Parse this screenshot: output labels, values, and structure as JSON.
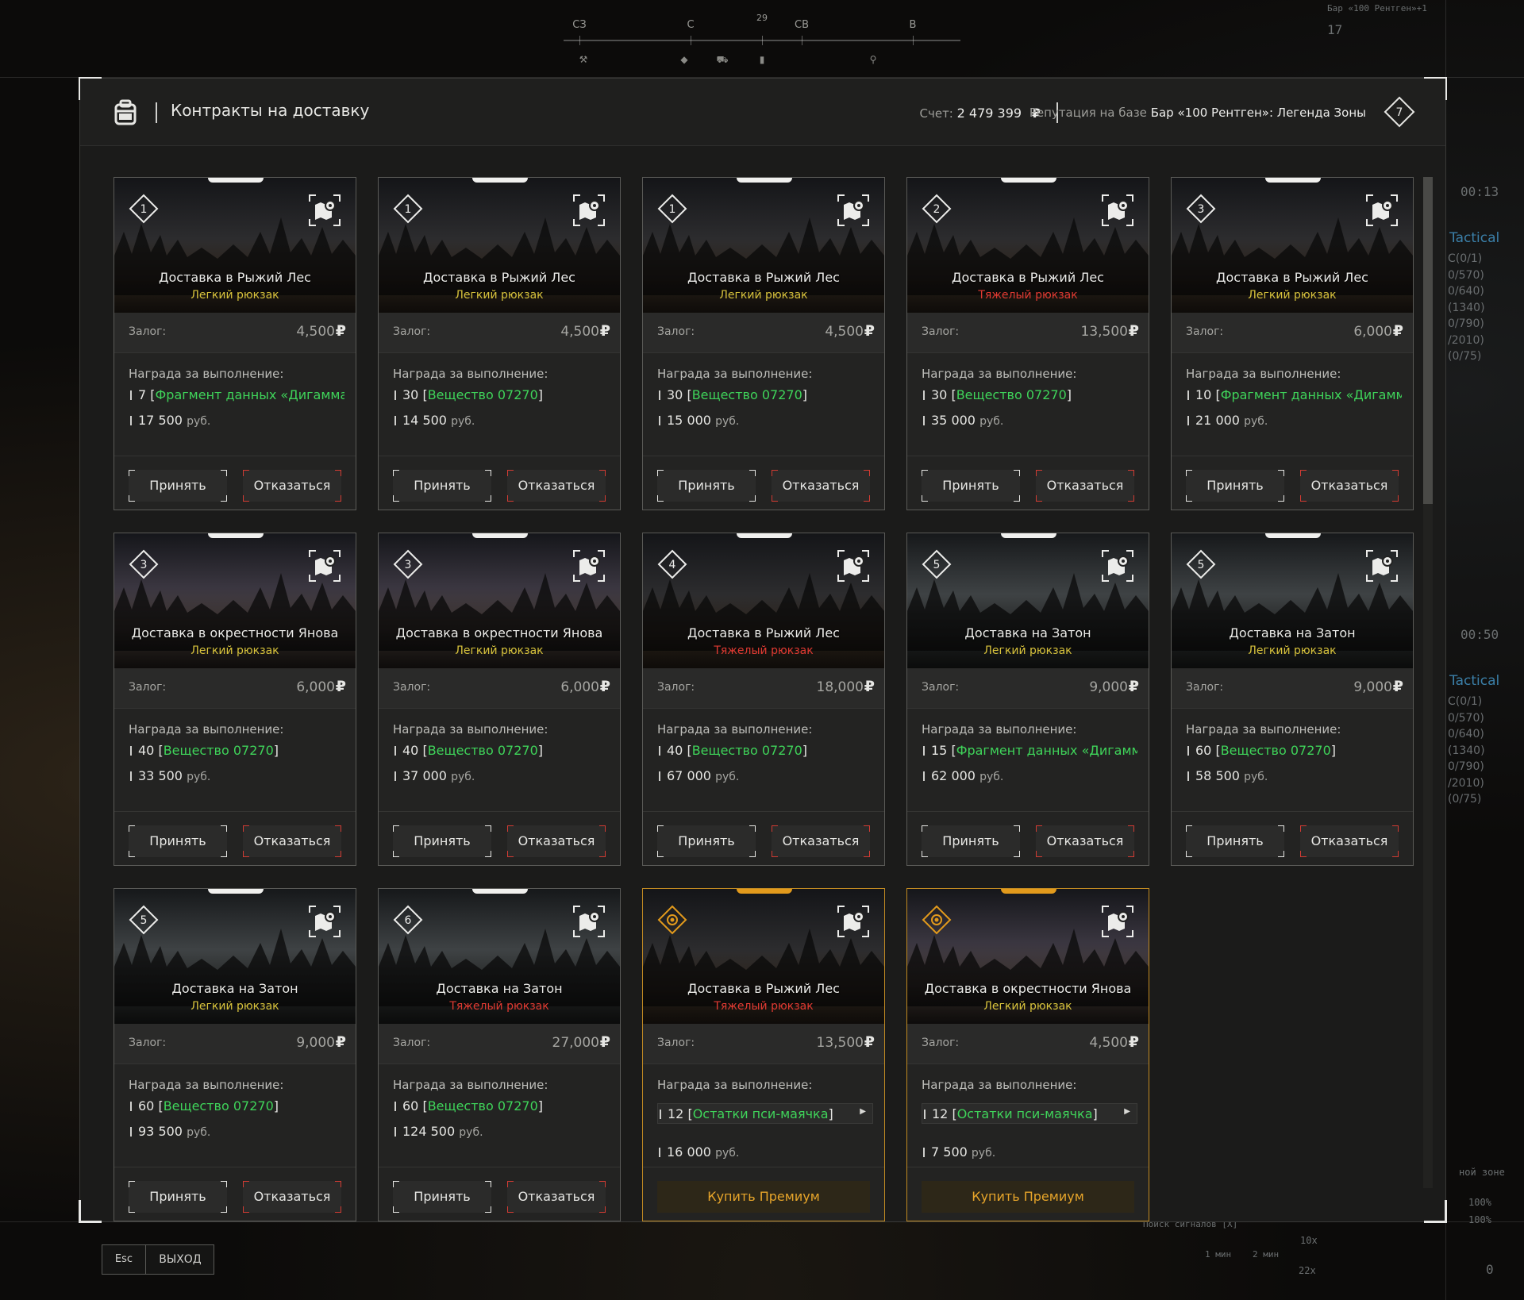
{
  "compass": {
    "labels": [
      "СЗ",
      "С",
      "29",
      "СВ",
      "В"
    ]
  },
  "hud": {
    "top_right_label": "Бар «100 Рентген»+1",
    "top_right_number": "17",
    "timer1": "00:13",
    "timer2": "00:50",
    "tactical": "Tactical",
    "stats": [
      "С(0/1)",
      "0/570)",
      "0/640)",
      "(1340)",
      "0/790)",
      "/2010)",
      "(0/75)"
    ],
    "zone_label": "ной зоне",
    "pct1": "100%",
    "pct2": "100%",
    "signal": "Поиск сигналов [X]",
    "t1": "1 мин",
    "t2": "2 мин",
    "count": "10x",
    "ammo": "22x",
    "zero": "0"
  },
  "header": {
    "title": "Контракты на доставку",
    "score_label": "Счет:",
    "score_value": "2 479 399",
    "currency": "₽",
    "rep_label": "Репутация на базе",
    "rep_value": "Бар «100 Рентген»: Легенда Зоны",
    "rep_level": "7"
  },
  "labels": {
    "deposit": "Залог:",
    "reward": "Награда за выполнение:",
    "rub": "руб.",
    "accept": "Принять",
    "decline": "Отказаться",
    "buy": "Купить Премиум",
    "currency": "₽"
  },
  "cards": [
    {
      "level": "1",
      "title": "Доставка в Рыжий Лес",
      "bag": "Легкий рюкзак",
      "heavy": false,
      "deposit": "4,500",
      "item_qty": "7",
      "item_name": "Фрагмент данных «Дигамма»",
      "money": "17 500",
      "premium": false,
      "bgvar": "v1"
    },
    {
      "level": "1",
      "title": "Доставка в Рыжий Лес",
      "bag": "Легкий рюкзак",
      "heavy": false,
      "deposit": "4,500",
      "item_qty": "30",
      "item_name": "Вещество 07270",
      "money": "14 500",
      "premium": false,
      "bgvar": "v1"
    },
    {
      "level": "1",
      "title": "Доставка в Рыжий Лес",
      "bag": "Легкий рюкзак",
      "heavy": false,
      "deposit": "4,500",
      "item_qty": "30",
      "item_name": "Вещество 07270",
      "money": "15 000",
      "premium": false,
      "bgvar": "v1"
    },
    {
      "level": "2",
      "title": "Доставка в Рыжий Лес",
      "bag": "Тяжелый рюкзак",
      "heavy": true,
      "deposit": "13,500",
      "item_qty": "30",
      "item_name": "Вещество 07270",
      "money": "35 000",
      "premium": false,
      "bgvar": "v1"
    },
    {
      "level": "3",
      "title": "Доставка в Рыжий Лес",
      "bag": "Легкий рюкзак",
      "heavy": false,
      "deposit": "6,000",
      "item_qty": "10",
      "item_name": "Фрагмент данных «Дигамма..",
      "money": "21 000",
      "premium": false,
      "bgvar": "v1"
    },
    {
      "level": "3",
      "title": "Доставка в окрестности Янова",
      "bag": "Легкий рюкзак",
      "heavy": false,
      "deposit": "6,000",
      "item_qty": "40",
      "item_name": "Вещество 07270",
      "money": "33 500",
      "premium": false,
      "bgvar": "v2"
    },
    {
      "level": "3",
      "title": "Доставка в окрестности Янова",
      "bag": "Легкий рюкзак",
      "heavy": false,
      "deposit": "6,000",
      "item_qty": "40",
      "item_name": "Вещество 07270",
      "money": "37 000",
      "premium": false,
      "bgvar": "v2"
    },
    {
      "level": "4",
      "title": "Доставка в Рыжий Лес",
      "bag": "Тяжелый рюкзак",
      "heavy": true,
      "deposit": "18,000",
      "item_qty": "40",
      "item_name": "Вещество 07270",
      "money": "67 000",
      "premium": false,
      "bgvar": "v1"
    },
    {
      "level": "5",
      "title": "Доставка на Затон",
      "bag": "Легкий рюкзак",
      "heavy": false,
      "deposit": "9,000",
      "item_qty": "15",
      "item_name": "Фрагмент данных «Дигамма..",
      "money": "62 000",
      "premium": false,
      "bgvar": "v3"
    },
    {
      "level": "5",
      "title": "Доставка на Затон",
      "bag": "Легкий рюкзак",
      "heavy": false,
      "deposit": "9,000",
      "item_qty": "60",
      "item_name": "Вещество 07270",
      "money": "58 500",
      "premium": false,
      "bgvar": "v3"
    },
    {
      "level": "5",
      "title": "Доставка на Затон",
      "bag": "Легкий рюкзак",
      "heavy": false,
      "deposit": "9,000",
      "item_qty": "60",
      "item_name": "Вещество 07270",
      "money": "93 500",
      "premium": false,
      "bgvar": "v3"
    },
    {
      "level": "6",
      "title": "Доставка на Затон",
      "bag": "Тяжелый рюкзак",
      "heavy": true,
      "deposit": "27,000",
      "item_qty": "60",
      "item_name": "Вещество 07270",
      "money": "124 500",
      "premium": false,
      "bgvar": "v3"
    },
    {
      "level": "",
      "title": "Доставка в Рыжий Лес",
      "bag": "Тяжелый рюкзак",
      "heavy": true,
      "deposit": "13,500",
      "item_qty": "12",
      "item_name": "Остатки пси-маячка",
      "money": "16 000",
      "premium": true,
      "bgvar": "v1"
    },
    {
      "level": "",
      "title": "Доставка в окрестности Янова",
      "bag": "Легкий рюкзак",
      "heavy": false,
      "deposit": "4,500",
      "item_qty": "12",
      "item_name": "Остатки пси-маячка",
      "money": "7 500",
      "premium": true,
      "bgvar": "v2"
    }
  ],
  "footer": {
    "esc": "Esc",
    "exit": "ВЫХОД"
  },
  "colors": {
    "accent_green": "#3fd45a",
    "light_bag": "#d7c23c",
    "heavy_bag": "#e03a32",
    "premium": "#e29a1c"
  }
}
